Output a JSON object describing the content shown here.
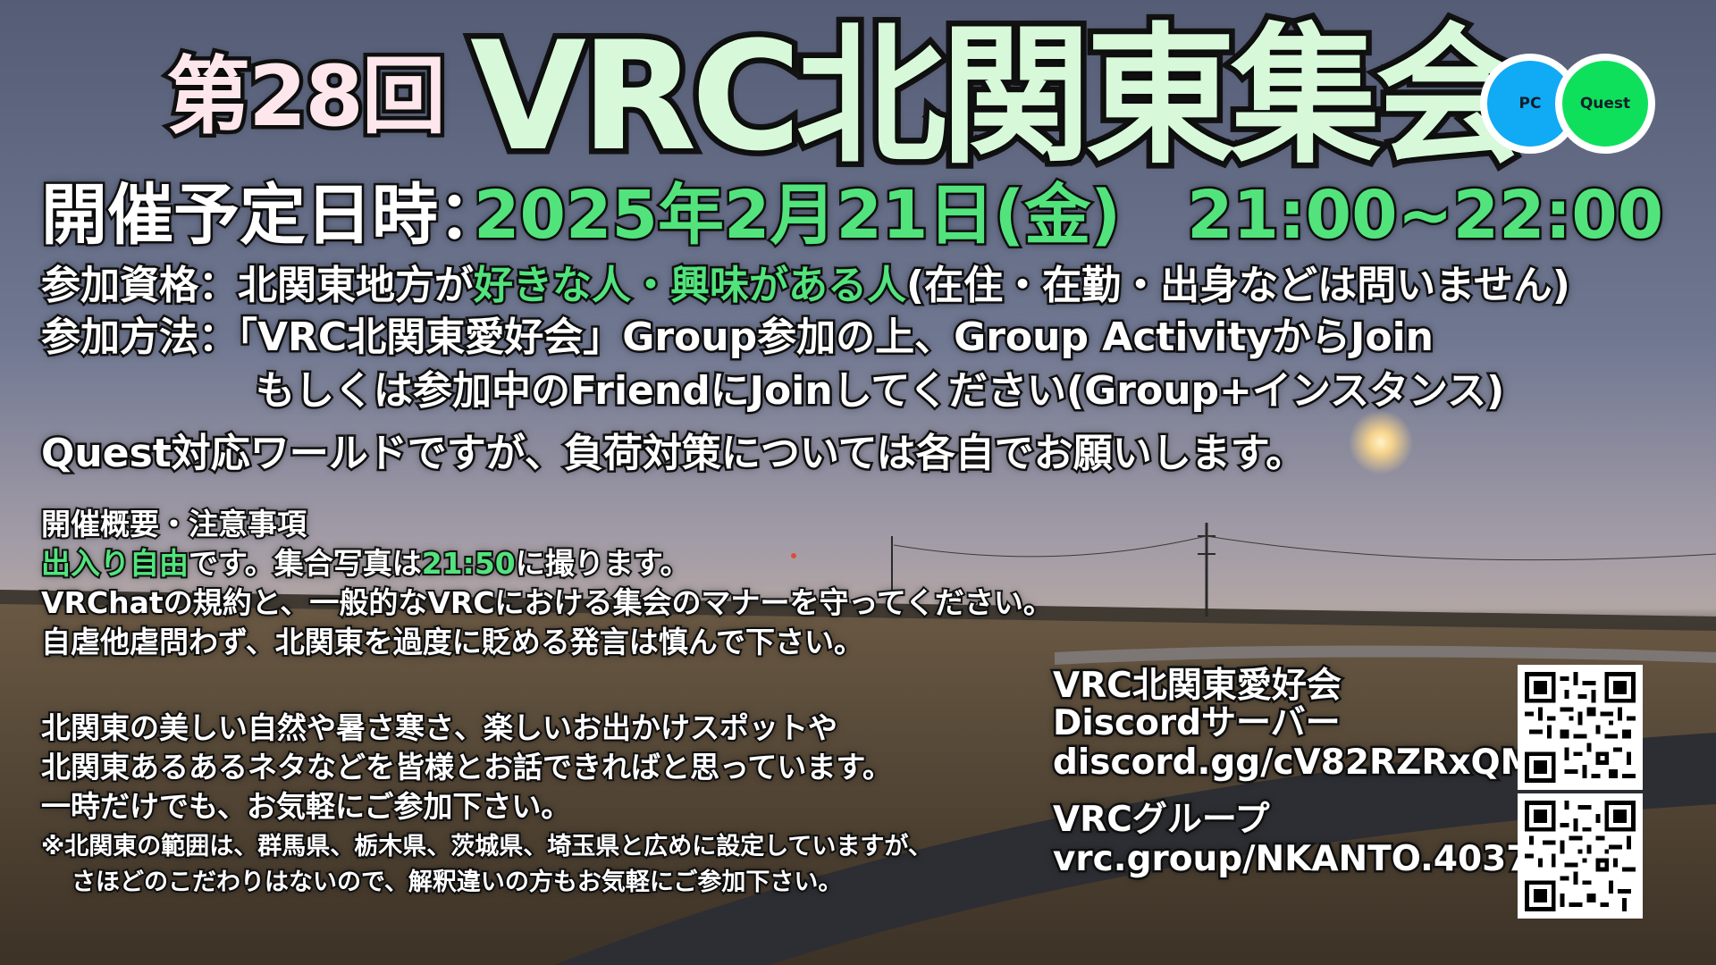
{
  "header": {
    "episode": "第28回",
    "title": "VRC北関東集会"
  },
  "platform_badges": {
    "pc": "PC",
    "quest": "Quest"
  },
  "schedule": {
    "label": "開催予定日時：",
    "value": "2025年2月21日(金)　21:00~22:00"
  },
  "participation": {
    "qualification_prefix": "参加資格：北関東地方が",
    "qualification_highlight": "好きな人・興味がある人",
    "qualification_suffix": "(在住・在勤・出身などは問いません)",
    "method_line1": "参加方法：「VRC北関東愛好会」Group参加の上、Group ActivityからJoin",
    "method_line2": "もしくは参加中のFriendにJoinしてください(Group+インスタンス)",
    "quest_note": "Quest対応ワールドですが、負荷対策については各自でお願いします。"
  },
  "notes": {
    "heading": "開催概要・注意事項",
    "free_entry": "出入り自由",
    "line1_mid": "です。集合写真は",
    "photo_time": "21:50",
    "line1_end": "に撮ります。",
    "line2": "VRChatの規約と、一般的なVRCにおける集会のマナーを守ってください。",
    "line3": "自虐他虐問わず、北関東を過度に貶める発言は慎んで下さい。",
    "line4": "北関東の美しい自然や暑さ寒さ、楽しいお出かけスポットや",
    "line5": "北関東あるあるネタなどを皆様とお話できればと思っています。",
    "line6": "一時だけでも、お気軽にご参加下さい。",
    "footnote1": "※北関東の範囲は、群馬県、栃木県、茨城県、埼玉県と広めに設定していますが、",
    "footnote2": "さほどのこだわりはないので、解釈違いの方もお気軽にご参加下さい。"
  },
  "discord": {
    "name": "VRC北関東愛好会",
    "label": "Discordサーバー",
    "url": "discord.gg/cV82RZRxQM"
  },
  "vrc_group": {
    "label": "VRCグループ",
    "url": "vrc.group/NKANTO.4037"
  },
  "colors": {
    "highlight_green": "#52e37d",
    "title_fill": "#d7f9da",
    "episode_fill": "#fde6ec",
    "pc_badge": "#11aaf4",
    "quest_badge": "#0fe05c"
  }
}
